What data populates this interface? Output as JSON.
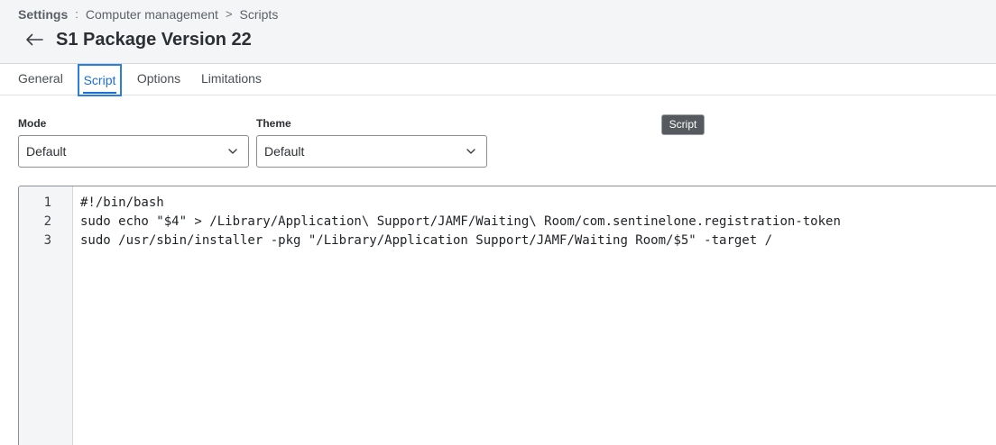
{
  "breadcrumb": {
    "root": "Settings",
    "separator": ":",
    "section": "Computer management",
    "chevron": ">",
    "current": "Scripts"
  },
  "page": {
    "title": "S1 Package Version 22",
    "back_icon": "arrow-left-icon"
  },
  "tabs": [
    {
      "label": "General",
      "active": false
    },
    {
      "label": "Script",
      "active": true
    },
    {
      "label": "Options",
      "active": false
    },
    {
      "label": "Limitations",
      "active": false
    }
  ],
  "tooltip": {
    "text": "Script"
  },
  "mode": {
    "label": "Mode",
    "value": "Default"
  },
  "theme": {
    "label": "Theme",
    "value": "Default"
  },
  "editor": {
    "line_numbers": [
      "1",
      "2",
      "3"
    ],
    "lines": [
      "#!/bin/bash",
      "sudo echo \"$4\" > /Library/Application\\ Support/JAMF/Waiting\\ Room/com.sentinelone.registration-token",
      "sudo /usr/sbin/installer -pkg \"/Library/Application Support/JAMF/Waiting Room/$5\" -target /"
    ]
  },
  "colors": {
    "accent": "#1d6fd1",
    "header_bg": "#f4f5f7",
    "tooltip_bg": "#56595e"
  }
}
